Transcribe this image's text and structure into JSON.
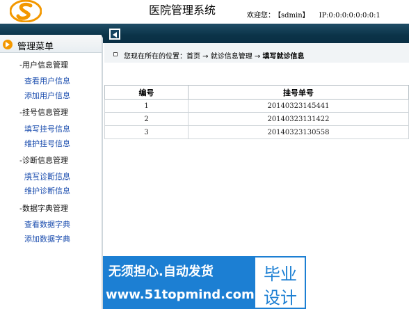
{
  "header": {
    "title": "医院管理系统",
    "welcome_label": "欢迎您：",
    "user": "【sdmin】",
    "ip": "IP:0:0:0:0:0:0:0:1"
  },
  "sidebar": {
    "title": "管理菜单",
    "groups": [
      {
        "title": "-用户信息管理",
        "items": [
          "查看用户信息",
          "添加用户信息"
        ]
      },
      {
        "title": "-挂号信息管理",
        "items": [
          "填写挂号信息",
          "维护挂号信息"
        ]
      },
      {
        "title": "-诊断信息管理",
        "items": [
          "填写诊断信息",
          "维护诊断信息"
        ]
      },
      {
        "title": "-数据字典管理",
        "items": [
          "查看数据字典",
          "添加数据字典"
        ]
      }
    ]
  },
  "breadcrumb": {
    "prefix": "您现在所在的位置：首页 → 就诊信息管理 → ",
    "current": "填写就诊信息"
  },
  "table": {
    "headers": [
      "编号",
      "挂号单号"
    ],
    "rows": [
      [
        "1",
        "20140323145441"
      ],
      [
        "2",
        "20140323131422"
      ],
      [
        "3",
        "20140323130558"
      ]
    ]
  },
  "banner": {
    "line1": "无须担心.自动发货",
    "line2": "www.51topmind.com",
    "right1": "毕业",
    "right2": "设计"
  },
  "colors": {
    "topbar": "#0b3348",
    "link": "#1a4cae",
    "accent": "#f39800",
    "banner": "#1c7fd3"
  }
}
